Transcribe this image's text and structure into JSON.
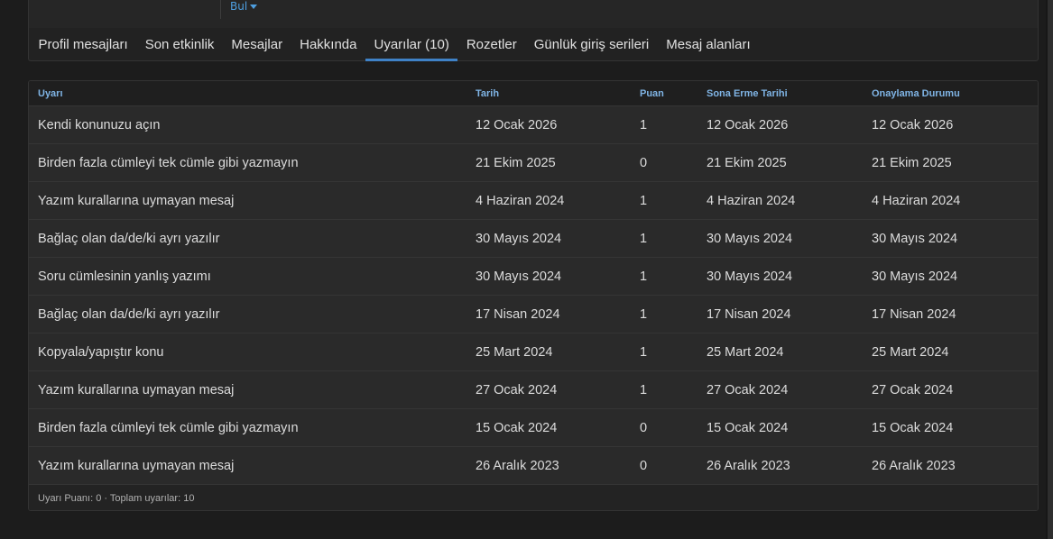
{
  "top_strip": {
    "find_label": "Bul"
  },
  "tabs": [
    {
      "label": "Profil mesajları",
      "active": false
    },
    {
      "label": "Son etkinlik",
      "active": false
    },
    {
      "label": "Mesajlar",
      "active": false
    },
    {
      "label": "Hakkında",
      "active": false
    },
    {
      "label": "Uyarılar (10)",
      "active": true
    },
    {
      "label": "Rozetler",
      "active": false
    },
    {
      "label": "Günlük giriş serileri",
      "active": false
    },
    {
      "label": "Mesaj alanları",
      "active": false
    }
  ],
  "table": {
    "headers": [
      "Uyarı",
      "Tarih",
      "Puan",
      "Sona Erme Tarihi",
      "Onaylama Durumu"
    ],
    "rows": [
      [
        "Kendi konunuzu açın",
        "12 Ocak 2026",
        "1",
        "12 Ocak 2026",
        "12 Ocak 2026"
      ],
      [
        "Birden fazla cümleyi tek cümle gibi yazmayın",
        "21 Ekim 2025",
        "0",
        "21 Ekim 2025",
        "21 Ekim 2025"
      ],
      [
        "Yazım kurallarına uymayan mesaj",
        "4 Haziran 2024",
        "1",
        "4 Haziran 2024",
        "4 Haziran 2024"
      ],
      [
        "Bağlaç olan da/de/ki ayrı yazılır",
        "30 Mayıs 2024",
        "1",
        "30 Mayıs 2024",
        "30 Mayıs 2024"
      ],
      [
        "Soru cümlesinin yanlış yazımı",
        "30 Mayıs 2024",
        "1",
        "30 Mayıs 2024",
        "30 Mayıs 2024"
      ],
      [
        "Bağlaç olan da/de/ki ayrı yazılır",
        "17 Nisan 2024",
        "1",
        "17 Nisan 2024",
        "17 Nisan 2024"
      ],
      [
        "Kopyala/yapıştır konu",
        "25 Mart 2024",
        "1",
        "25 Mart 2024",
        "25 Mart 2024"
      ],
      [
        "Yazım kurallarına uymayan mesaj",
        "27 Ocak 2024",
        "1",
        "27 Ocak 2024",
        "27 Ocak 2024"
      ],
      [
        "Birden fazla cümleyi tek cümle gibi yazmayın",
        "15 Ocak 2024",
        "0",
        "15 Ocak 2024",
        "15 Ocak 2024"
      ],
      [
        "Yazım kurallarına uymayan mesaj",
        "26 Aralık 2023",
        "0",
        "26 Aralık 2023",
        "26 Aralık 2023"
      ]
    ],
    "footer": "Uyarı Puanı: 0 · Toplam uyarılar: 10"
  },
  "colors": {
    "accent": "#3f82c7",
    "link": "#4e9fe0",
    "header_text": "#7fb4e5",
    "background": "#1c1c1c"
  }
}
